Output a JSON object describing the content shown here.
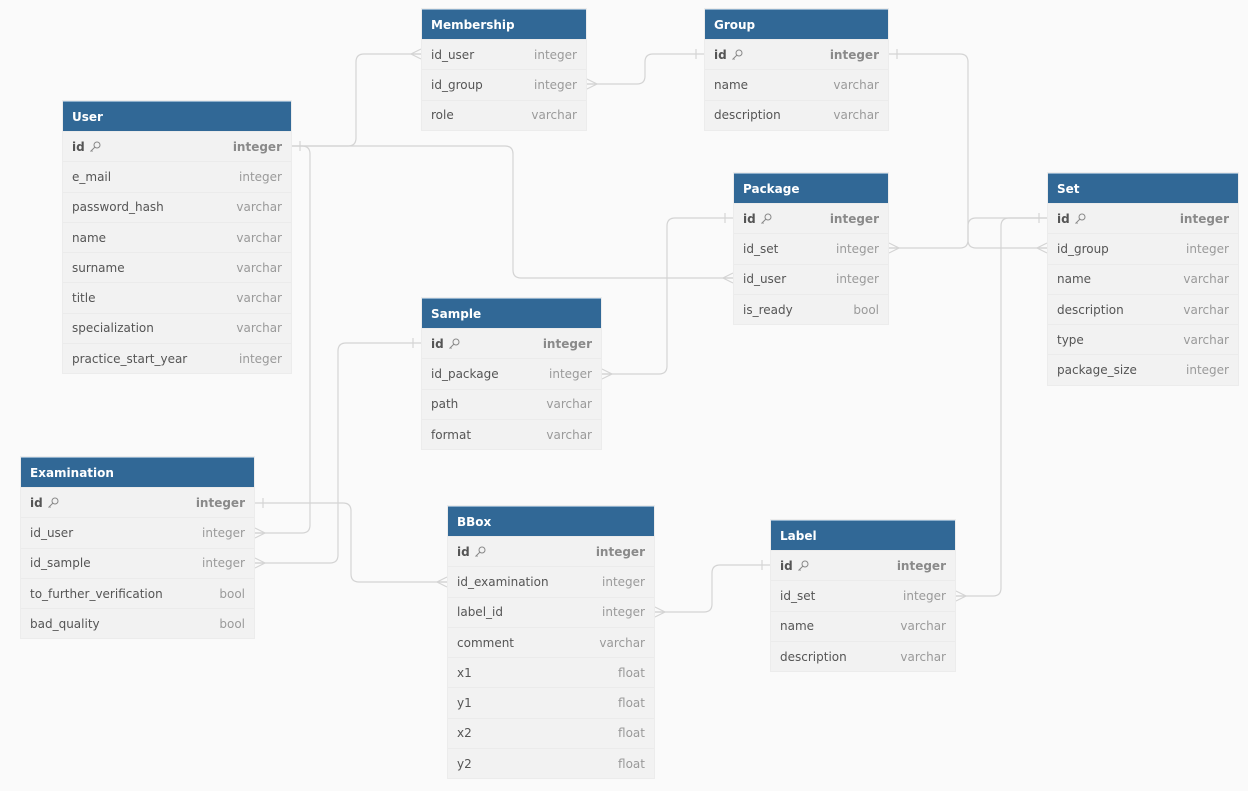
{
  "diagram": {
    "type": "entity-relationship",
    "header_color": "#316896",
    "line_color": "#d4d4d4",
    "tables": [
      {
        "id": "membership",
        "name": "Membership",
        "fields": [
          {
            "name": "id_user",
            "type": "integer"
          },
          {
            "name": "id_group",
            "type": "integer"
          },
          {
            "name": "role",
            "type": "varchar"
          }
        ]
      },
      {
        "id": "group",
        "name": "Group",
        "fields": [
          {
            "name": "id",
            "type": "integer",
            "pk": true,
            "icon": "key-icon"
          },
          {
            "name": "name",
            "type": "varchar"
          },
          {
            "name": "description",
            "type": "varchar"
          }
        ]
      },
      {
        "id": "user",
        "name": "User",
        "fields": [
          {
            "name": "id",
            "type": "integer",
            "pk": true,
            "icon": "key-icon"
          },
          {
            "name": "e_mail",
            "type": "integer"
          },
          {
            "name": "password_hash",
            "type": "varchar"
          },
          {
            "name": "name",
            "type": "varchar"
          },
          {
            "name": "surname",
            "type": "varchar"
          },
          {
            "name": "title",
            "type": "varchar"
          },
          {
            "name": "specialization",
            "type": "varchar"
          },
          {
            "name": "practice_start_year",
            "type": "integer"
          }
        ]
      },
      {
        "id": "package",
        "name": "Package",
        "fields": [
          {
            "name": "id",
            "type": "integer",
            "pk": true,
            "icon": "key-icon"
          },
          {
            "name": "id_set",
            "type": "integer"
          },
          {
            "name": "id_user",
            "type": "integer"
          },
          {
            "name": "is_ready",
            "type": "bool"
          }
        ]
      },
      {
        "id": "set",
        "name": "Set",
        "fields": [
          {
            "name": "id",
            "type": "integer",
            "pk": true,
            "icon": "key-icon"
          },
          {
            "name": "id_group",
            "type": "integer"
          },
          {
            "name": "name",
            "type": "varchar"
          },
          {
            "name": "description",
            "type": "varchar"
          },
          {
            "name": "type",
            "type": "varchar"
          },
          {
            "name": "package_size",
            "type": "integer"
          }
        ]
      },
      {
        "id": "sample",
        "name": "Sample",
        "fields": [
          {
            "name": "id",
            "type": "integer",
            "pk": true,
            "icon": "key-icon"
          },
          {
            "name": "id_package",
            "type": "integer"
          },
          {
            "name": "path",
            "type": "varchar"
          },
          {
            "name": "format",
            "type": "varchar"
          }
        ]
      },
      {
        "id": "examination",
        "name": "Examination",
        "fields": [
          {
            "name": "id",
            "type": "integer",
            "pk": true,
            "icon": "key-icon"
          },
          {
            "name": "id_user",
            "type": "integer"
          },
          {
            "name": "id_sample",
            "type": "integer"
          },
          {
            "name": "to_further_verification",
            "type": "bool"
          },
          {
            "name": "bad_quality",
            "type": "bool"
          }
        ]
      },
      {
        "id": "bbox",
        "name": "BBox",
        "fields": [
          {
            "name": "id",
            "type": "integer",
            "pk": true,
            "icon": "key-icon"
          },
          {
            "name": "id_examination",
            "type": "integer"
          },
          {
            "name": "label_id",
            "type": "integer"
          },
          {
            "name": "comment",
            "type": "varchar"
          },
          {
            "name": "x1",
            "type": "float"
          },
          {
            "name": "y1",
            "type": "float"
          },
          {
            "name": "x2",
            "type": "float"
          },
          {
            "name": "y2",
            "type": "float"
          }
        ]
      },
      {
        "id": "label",
        "name": "Label",
        "fields": [
          {
            "name": "id",
            "type": "integer",
            "pk": true,
            "icon": "key-icon"
          },
          {
            "name": "id_set",
            "type": "integer"
          },
          {
            "name": "name",
            "type": "varchar"
          },
          {
            "name": "description",
            "type": "varchar"
          }
        ]
      }
    ],
    "relationships": [
      {
        "from": "membership.id_user",
        "to": "user.id",
        "type": "many-to-one"
      },
      {
        "from": "membership.id_group",
        "to": "group.id",
        "type": "many-to-one"
      },
      {
        "from": "set.id_group",
        "to": "group.id",
        "type": "many-to-one"
      },
      {
        "from": "package.id_set",
        "to": "set.id",
        "type": "many-to-one"
      },
      {
        "from": "package.id_user",
        "to": "user.id",
        "type": "many-to-one"
      },
      {
        "from": "sample.id_package",
        "to": "package.id",
        "type": "many-to-one"
      },
      {
        "from": "examination.id_user",
        "to": "user.id",
        "type": "many-to-one"
      },
      {
        "from": "examination.id_sample",
        "to": "sample.id",
        "type": "many-to-one"
      },
      {
        "from": "bbox.id_examination",
        "to": "examination.id",
        "type": "many-to-one"
      },
      {
        "from": "bbox.label_id",
        "to": "label.id",
        "type": "many-to-one"
      },
      {
        "from": "label.id_set",
        "to": "set.id",
        "type": "many-to-one"
      }
    ]
  }
}
